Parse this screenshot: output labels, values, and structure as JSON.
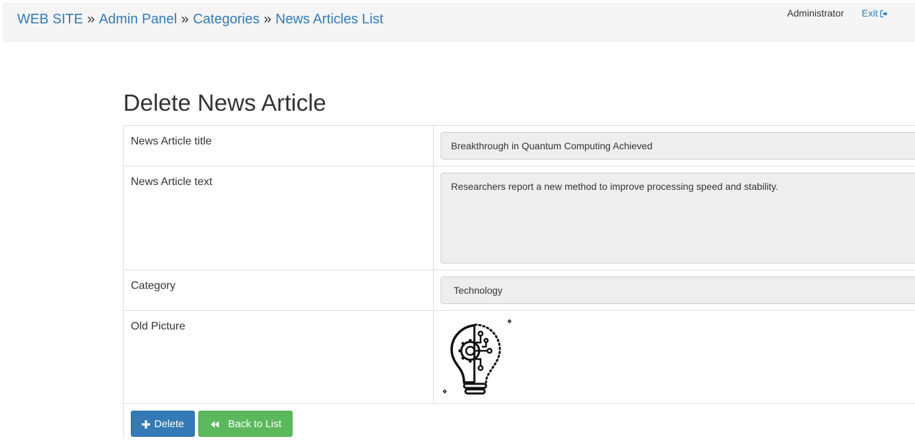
{
  "breadcrumb": {
    "items": [
      "WEB SITE",
      "Admin Panel",
      "Categories",
      "News Articles List"
    ],
    "separator": "»"
  },
  "user": {
    "name": "Administrator",
    "exit_label": "Exit",
    "exit_icon": "log-out-icon"
  },
  "page": {
    "title": "Delete News Article"
  },
  "form": {
    "rows": [
      {
        "label": "News Article title",
        "value": "Breakthrough in Quantum Computing Achieved"
      },
      {
        "label": "News Article text",
        "value": "Researchers report a new method to improve processing speed and stability."
      },
      {
        "label": "Category",
        "value": "Technology"
      },
      {
        "label": "Old Picture",
        "picture_icon": "lightbulb-circuit-icon"
      }
    ]
  },
  "actions": {
    "delete_label": "Delete",
    "delete_icon": "plus-icon",
    "back_label": "Back to List",
    "back_icon": "backward-icon"
  },
  "colors": {
    "link": "#337ab7",
    "primary": "#337ab7",
    "success": "#5cb85c",
    "readonly_bg": "#eeeeee"
  }
}
